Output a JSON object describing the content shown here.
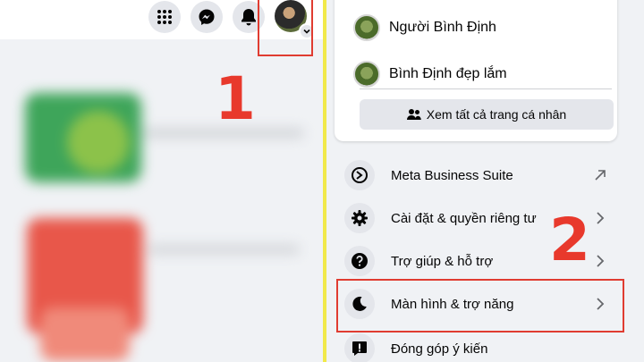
{
  "annotations": {
    "step1": "1",
    "step2": "2"
  },
  "topbar": {
    "menu_icon": "grid-menu-icon",
    "messenger_icon": "messenger-icon",
    "notification_icon": "bell-icon",
    "account_icon": "avatar",
    "account_badge_icon": "chevron-down-icon"
  },
  "profiles": [
    {
      "name": "Người Bình Định"
    },
    {
      "name": "Bình Định đẹp lắm"
    }
  ],
  "see_all_label": "Xem tất cả trang cá nhân",
  "menu": [
    {
      "label": "Meta Business Suite",
      "icon": "meta-business-icon",
      "arrow": "external-link-icon"
    },
    {
      "label": "Cài đặt & quyền riêng tư",
      "icon": "gear-icon",
      "arrow": "chevron-right-icon"
    },
    {
      "label": "Trợ giúp & hỗ trợ",
      "icon": "help-icon",
      "arrow": "chevron-right-icon"
    },
    {
      "label": "Màn hình & trợ năng",
      "icon": "moon-icon",
      "arrow": "chevron-right-icon"
    },
    {
      "label": "Đóng góp ý kiến",
      "icon": "feedback-icon",
      "arrow": ""
    }
  ],
  "colors": {
    "highlight": "#e03c31",
    "divider": "#f1e94a",
    "panel_bg": "#f0f2f5"
  }
}
